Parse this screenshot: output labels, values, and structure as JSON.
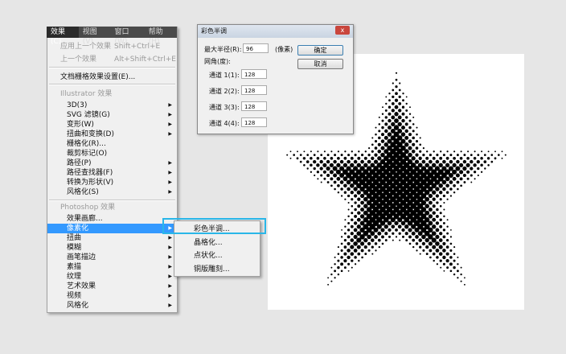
{
  "menubar": [
    "效果(C)",
    "视图(V)",
    "窗口(W)",
    "帮助(H)"
  ],
  "menu": {
    "apply_last": {
      "label": "应用上一个效果",
      "shortcut": "Shift+Ctrl+E"
    },
    "last": {
      "label": "上一个效果",
      "shortcut": "Alt+Shift+Ctrl+E"
    },
    "doc_raster": "文档栅格效果设置(E)...",
    "illustrator_header": "Illustrator 效果",
    "illustrator_items": [
      {
        "label": "3D(3)",
        "submenu": true
      },
      {
        "label": "SVG 滤镜(G)",
        "submenu": true
      },
      {
        "label": "变形(W)",
        "submenu": true
      },
      {
        "label": "扭曲和变换(D)",
        "submenu": true
      },
      {
        "label": "栅格化(R)...",
        "submenu": false
      },
      {
        "label": "裁剪标记(O)",
        "submenu": false
      },
      {
        "label": "路径(P)",
        "submenu": true
      },
      {
        "label": "路径查找器(F)",
        "submenu": true
      },
      {
        "label": "转换为形状(V)",
        "submenu": true
      },
      {
        "label": "风格化(S)",
        "submenu": true
      }
    ],
    "photoshop_header": "Photoshop 效果",
    "photoshop_items": [
      {
        "label": "效果画廊...",
        "submenu": false
      },
      {
        "label": "像素化",
        "submenu": true,
        "highlighted": true
      },
      {
        "label": "扭曲",
        "submenu": true
      },
      {
        "label": "模糊",
        "submenu": true
      },
      {
        "label": "画笔描边",
        "submenu": true
      },
      {
        "label": "素描",
        "submenu": true
      },
      {
        "label": "纹理",
        "submenu": true
      },
      {
        "label": "艺术效果",
        "submenu": true
      },
      {
        "label": "视频",
        "submenu": true
      },
      {
        "label": "风格化",
        "submenu": true
      }
    ]
  },
  "submenu": [
    "彩色半调...",
    "晶格化...",
    "点状化...",
    "铜版雕刻..."
  ],
  "dialog": {
    "title": "彩色半调",
    "close": "x",
    "max_radius_label": "最大半径(R):",
    "max_radius": "96",
    "unit": "(像素)",
    "angle_label": "网角(度):",
    "channels": [
      {
        "label": "通道 1(1):",
        "value": "128"
      },
      {
        "label": "通道 2(2):",
        "value": "128"
      },
      {
        "label": "通道 3(3):",
        "value": "128"
      },
      {
        "label": "通道 4(4):",
        "value": "128"
      }
    ],
    "ok": "确定",
    "cancel": "取消"
  },
  "colors": {
    "highlight": "#3399ff",
    "callout": "#29b6e8"
  }
}
